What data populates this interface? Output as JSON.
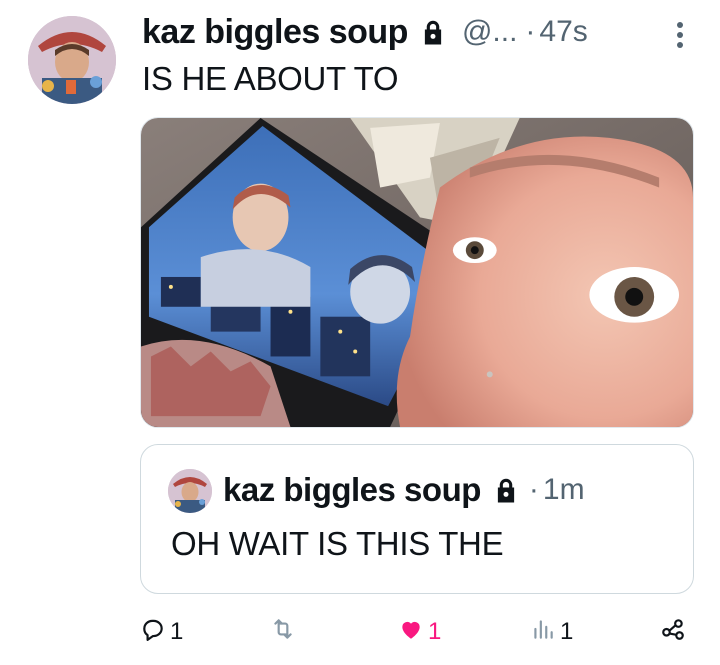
{
  "tweet": {
    "display_name": "kaz biggles soup",
    "handle": "@...",
    "separator": "·",
    "time": "47s",
    "text": "IS HE ABOUT TO"
  },
  "quote": {
    "display_name": "kaz biggles soup",
    "separator": "·",
    "time": "1m",
    "text": "OH WAIT IS THIS THE"
  },
  "actions": {
    "replies": "1",
    "retweets": "",
    "likes": "1",
    "views": "1"
  },
  "colors": {
    "like_active": "#f91880",
    "muted": "#536471",
    "text": "#0f1419"
  },
  "icons": [
    "lock-icon",
    "more-icon",
    "reply-icon",
    "retweet-icon",
    "heart-icon",
    "views-icon",
    "share-icon"
  ]
}
